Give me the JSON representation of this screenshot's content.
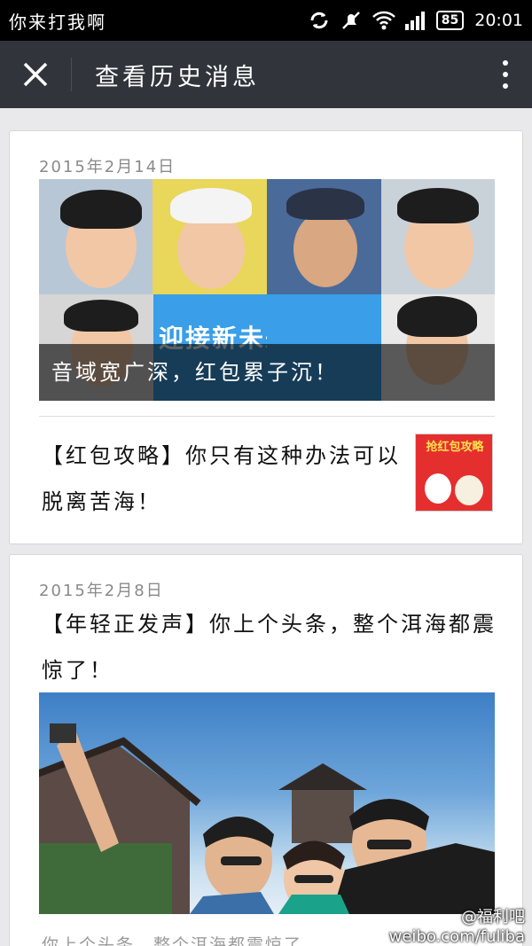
{
  "status_bar": {
    "carrier": "你来打我啊",
    "battery": "85",
    "time": "20:01",
    "icons": [
      "sync-icon",
      "mute-icon",
      "wifi-icon",
      "signal-icon",
      "battery-icon"
    ]
  },
  "title_bar": {
    "title": "查看历史消息",
    "close_icon": "close-icon",
    "more_icon": "more-vertical-icon"
  },
  "messages": [
    {
      "date": "2015年2月14日",
      "cover_banner": "迎接新未来",
      "cover_title": "音域宽广深，红包累子沉！",
      "article_title": "【红包攻略】你只有这种办法可以脱离苦海！",
      "thumb_text": "抢红包攻略"
    },
    {
      "date": "2015年2月8日",
      "article_title": "【年轻正发声】你上个头条，整个洱海都震惊了！",
      "snippet": "你上个头条，整个洱海都震惊了"
    }
  ],
  "watermark": {
    "handle": "@福利吧",
    "site": "weibo.com/fuliba"
  },
  "colors": {
    "title_bar_bg": "#31353b",
    "status_bar_bg": "#000000",
    "page_bg": "#e9e9eb"
  }
}
